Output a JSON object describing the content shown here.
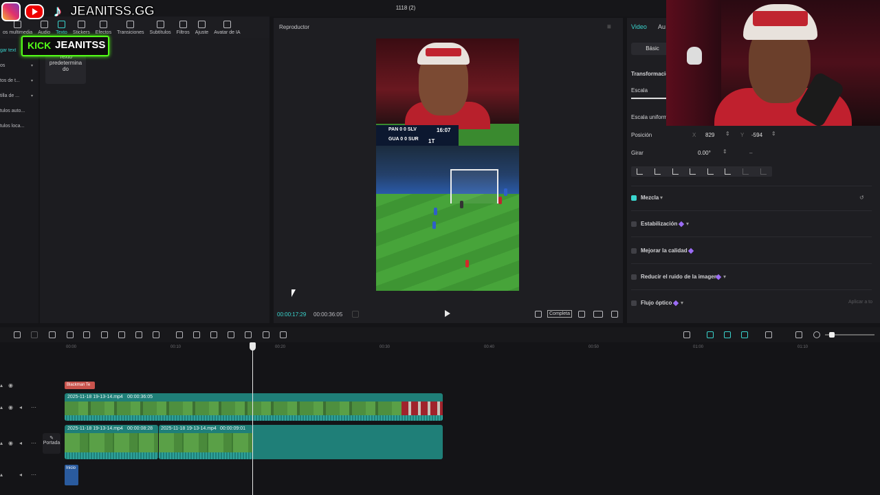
{
  "window": {
    "title": "1118 (2)"
  },
  "toolbar": {
    "items": [
      {
        "label": "os multimedia",
        "icon": "media-icon"
      },
      {
        "label": "Audio",
        "icon": "audio-icon"
      },
      {
        "label": "Texto",
        "icon": "text-icon",
        "active": true
      },
      {
        "label": "Stickers",
        "icon": "sticker-icon"
      },
      {
        "label": "Efectos",
        "icon": "effects-icon"
      },
      {
        "label": "Transiciones",
        "icon": "transitions-icon"
      },
      {
        "label": "Subtítulos",
        "icon": "subtitles-icon"
      },
      {
        "label": "Filtros",
        "icon": "filters-icon"
      },
      {
        "label": "Ajuste",
        "icon": "adjust-icon"
      },
      {
        "label": "Avatar de IA",
        "icon": "avatar-icon"
      }
    ]
  },
  "left_nav": {
    "items": [
      {
        "label": "gar text",
        "chevron": false
      },
      {
        "label": "os",
        "chevron": true
      },
      {
        "label": "tos de t...",
        "chevron": true
      },
      {
        "label": "tilla de ...",
        "chevron": true
      },
      {
        "label": "tulos auto...",
        "chevron": false
      },
      {
        "label": "tulos loca...",
        "chevron": false
      }
    ]
  },
  "text_card": {
    "label": "Texto predeterminado",
    "lines": [
      "Texto",
      "predetermina",
      "do"
    ]
  },
  "overlay": {
    "brand": "JEANITSS.GG",
    "kick_label": "KICK",
    "kick_name": "JEANITSS",
    "icons": [
      "instagram-icon",
      "youtube-icon",
      "tiktok-icon"
    ],
    "kick_color": "#53fc18"
  },
  "player": {
    "title": "Reproductor",
    "current_time": "00:00:17:29",
    "duration": "00:00:36:05",
    "ratio_button": "Completa",
    "scoreboard": {
      "row1": "PAN  0  0  SLV",
      "row2": "GUA  0  0  SUR",
      "clock": "16:07",
      "period": "1T"
    }
  },
  "right_panel": {
    "tabs": [
      {
        "label": "Video",
        "active": true
      },
      {
        "label": "Au",
        "active": false
      }
    ],
    "basic_button": "Básic",
    "section_transform": "Transformació",
    "tab_scale": "Escala",
    "uniform_scale": "Escala uniform",
    "position_label": "Posición",
    "x_label": "X",
    "x_value": "829",
    "y_label": "Y",
    "y_value": "-594",
    "rotate_label": "Girar",
    "rotate_value": "0.00°",
    "blend": {
      "label": "Mezcla",
      "checked": true
    },
    "stabilization": {
      "label": "Estabilización",
      "checked": false
    },
    "quality": {
      "label": "Mejorar la calidad",
      "checked": false
    },
    "noise": {
      "label": "Reducir el ruido de la imagen",
      "checked": false
    },
    "optical_flow": {
      "label": "Flujo óptico",
      "checked": false
    },
    "apply_button": "Aplicar a to"
  },
  "timeline": {
    "ruler": [
      "00:00",
      "00:10",
      "00:20",
      "00:30",
      "00:40",
      "00:50",
      "01:00",
      "01:10"
    ],
    "text_clip": "Blackman Te",
    "main_clip": {
      "name": "2025-11-18 19-13-14.mp4",
      "duration": "00:00:36:05"
    },
    "clip_a": {
      "name": "2025-11-18 19-13-14.mp4",
      "duration": "00:00:08:28"
    },
    "clip_b": {
      "name": "2025-11-18 19-13-14.mp4",
      "duration": "00:00:09:01"
    },
    "cover_label": "Portada",
    "audio_clip": "Inicio"
  }
}
